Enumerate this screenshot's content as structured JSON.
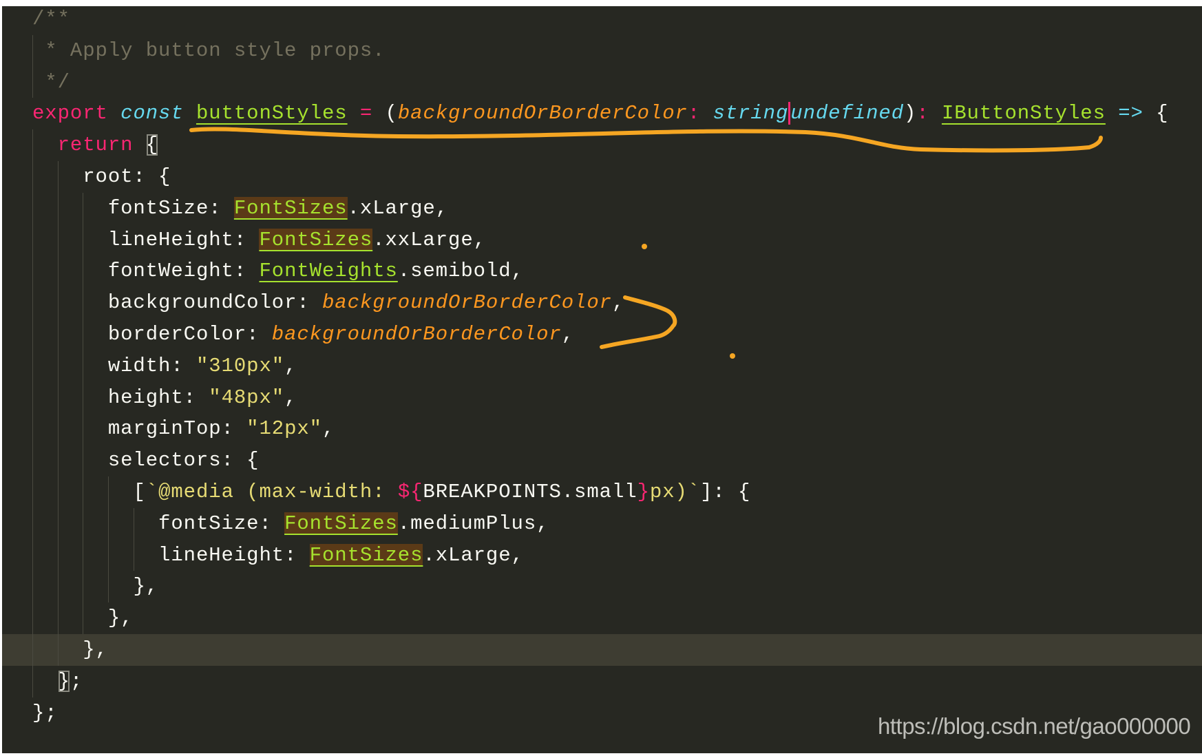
{
  "editor": {
    "theme_colors": {
      "background": "#272822",
      "comment": "#75715e",
      "keyword": "#f92672",
      "storage": "#66d9ef",
      "function": "#a6e22e",
      "parameter": "#fd971f",
      "string": "#e6db74",
      "text": "#f8f8f2",
      "annotation": "#f5a623"
    },
    "current_line": 21,
    "lines": [
      {
        "indent": 0,
        "tokens": [
          {
            "t": "/**",
            "c": "cmt"
          }
        ]
      },
      {
        "indent": 0,
        "guides": [
          0
        ],
        "tokens": [
          {
            "t": " * Apply button style props.",
            "c": "cmt"
          }
        ]
      },
      {
        "indent": 0,
        "guides": [
          0
        ],
        "tokens": [
          {
            "t": " */",
            "c": "cmt"
          }
        ]
      },
      {
        "indent": 0,
        "tokens": [
          {
            "t": "export",
            "c": "kw"
          },
          {
            "t": " "
          },
          {
            "t": "const",
            "c": "st"
          },
          {
            "t": " "
          },
          {
            "t": "buttonStyles",
            "c": "fn"
          },
          {
            "t": " "
          },
          {
            "t": "=",
            "c": "op"
          },
          {
            "t": " ("
          },
          {
            "t": "backgroundOrBorderColor",
            "c": "prm"
          },
          {
            "t": ":",
            "c": "op"
          },
          {
            "t": " "
          },
          {
            "t": "string",
            "c": "st"
          },
          {
            "t": "undefined",
            "c": "st caret"
          },
          {
            "t": ")"
          },
          {
            "t": ":",
            "c": "op"
          },
          {
            "t": " "
          },
          {
            "t": "IButtonStyles",
            "c": "fn"
          },
          {
            "t": " "
          },
          {
            "t": "=>",
            "c": "arrow"
          },
          {
            "t": " {"
          }
        ]
      },
      {
        "indent": 2,
        "guides": [
          0
        ],
        "tokens": [
          {
            "t": "return",
            "c": "kw"
          },
          {
            "t": " "
          },
          {
            "t": "{",
            "c": "match"
          }
        ]
      },
      {
        "indent": 4,
        "guides": [
          0,
          2
        ],
        "tokens": [
          {
            "t": "root: {"
          }
        ]
      },
      {
        "indent": 6,
        "guides": [
          0,
          2,
          4
        ],
        "tokens": [
          {
            "t": "fontSize: "
          },
          {
            "t": "FontSizes",
            "c": "hl"
          },
          {
            "t": ".xLarge,"
          }
        ]
      },
      {
        "indent": 6,
        "guides": [
          0,
          2,
          4
        ],
        "tokens": [
          {
            "t": "lineHeight: "
          },
          {
            "t": "FontSizes",
            "c": "hl"
          },
          {
            "t": ".xxLarge,"
          }
        ]
      },
      {
        "indent": 6,
        "guides": [
          0,
          2,
          4
        ],
        "tokens": [
          {
            "t": "fontWeight: "
          },
          {
            "t": "FontWeights",
            "c": "fn"
          },
          {
            "t": ".semibold,"
          }
        ]
      },
      {
        "indent": 6,
        "guides": [
          0,
          2,
          4
        ],
        "tokens": [
          {
            "t": "backgroundColor: "
          },
          {
            "t": "backgroundOrBorderColor",
            "c": "prm"
          },
          {
            "t": ","
          }
        ]
      },
      {
        "indent": 6,
        "guides": [
          0,
          2,
          4
        ],
        "tokens": [
          {
            "t": "borderColor: "
          },
          {
            "t": "backgroundOrBorderColor",
            "c": "prm"
          },
          {
            "t": ","
          }
        ]
      },
      {
        "indent": 6,
        "guides": [
          0,
          2,
          4
        ],
        "tokens": [
          {
            "t": "width: "
          },
          {
            "t": "\"310px\"",
            "c": "str"
          },
          {
            "t": ","
          }
        ]
      },
      {
        "indent": 6,
        "guides": [
          0,
          2,
          4
        ],
        "tokens": [
          {
            "t": "height: "
          },
          {
            "t": "\"48px\"",
            "c": "str"
          },
          {
            "t": ","
          }
        ]
      },
      {
        "indent": 6,
        "guides": [
          0,
          2,
          4
        ],
        "tokens": [
          {
            "t": "marginTop: "
          },
          {
            "t": "\"12px\"",
            "c": "str"
          },
          {
            "t": ","
          }
        ]
      },
      {
        "indent": 6,
        "guides": [
          0,
          2,
          4
        ],
        "tokens": [
          {
            "t": "selectors: {"
          }
        ]
      },
      {
        "indent": 8,
        "guides": [
          0,
          2,
          4,
          6
        ],
        "tokens": [
          {
            "t": "["
          },
          {
            "t": "`@media (max-width: ",
            "c": "str"
          },
          {
            "t": "${",
            "c": "kw"
          },
          {
            "t": "BREAKPOINTS.small"
          },
          {
            "t": "}",
            "c": "kw"
          },
          {
            "t": "px)`",
            "c": "str"
          },
          {
            "t": "]: {"
          }
        ]
      },
      {
        "indent": 10,
        "guides": [
          0,
          2,
          4,
          6,
          8
        ],
        "tokens": [
          {
            "t": "fontSize: "
          },
          {
            "t": "FontSizes",
            "c": "hl"
          },
          {
            "t": ".mediumPlus,"
          }
        ]
      },
      {
        "indent": 10,
        "guides": [
          0,
          2,
          4,
          6,
          8
        ],
        "tokens": [
          {
            "t": "lineHeight: "
          },
          {
            "t": "FontSizes",
            "c": "hl"
          },
          {
            "t": ".xLarge,"
          }
        ]
      },
      {
        "indent": 8,
        "guides": [
          0,
          2,
          4,
          6
        ],
        "tokens": [
          {
            "t": "},"
          }
        ]
      },
      {
        "indent": 6,
        "guides": [
          0,
          2,
          4
        ],
        "tokens": [
          {
            "t": "},"
          }
        ]
      },
      {
        "indent": 4,
        "guides": [
          0,
          2
        ],
        "tokens": [
          {
            "t": "},"
          }
        ]
      },
      {
        "indent": 2,
        "guides": [
          0
        ],
        "tokens": [
          {
            "t": "}",
            "c": "match"
          },
          {
            "t": ";"
          }
        ]
      },
      {
        "indent": 0,
        "tokens": [
          {
            "t": "};"
          }
        ]
      }
    ]
  },
  "watermark": "https://blog.csdn.net/gao000000"
}
